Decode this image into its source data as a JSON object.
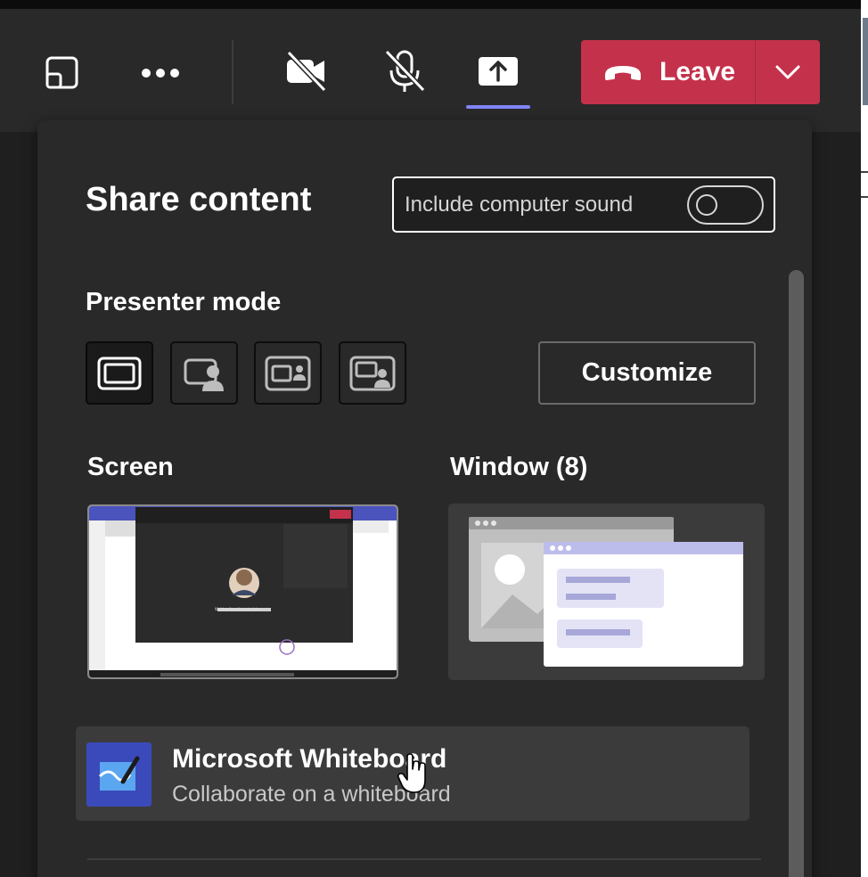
{
  "toolbar": {
    "leave_label": "Leave"
  },
  "panel": {
    "title": "Share content",
    "sound_label": "Include computer sound",
    "sound_enabled": false,
    "presenter_mode_heading": "Presenter mode",
    "customize_label": "Customize",
    "screen_heading": "Screen",
    "window_heading": "Window (8)",
    "whiteboard": {
      "title": "Microsoft Whiteboard",
      "subtitle": "Collaborate on a whiteboard"
    }
  },
  "screen_preview": {
    "waiting_text": "Waiting for others to join..."
  },
  "colors": {
    "accent": "#7f85f5",
    "leave": "#c4314b",
    "whiteboard": "#3b4aba",
    "window_illustration": "#bdbdeb"
  },
  "icons": {
    "popout": "popout-icon",
    "more": "more-options-icon",
    "camera_off": "camera-off-icon",
    "mic_off": "mic-off-icon",
    "share": "share-tray-icon",
    "phone": "phone-hangup-icon",
    "chevron": "chevron-down-icon"
  }
}
